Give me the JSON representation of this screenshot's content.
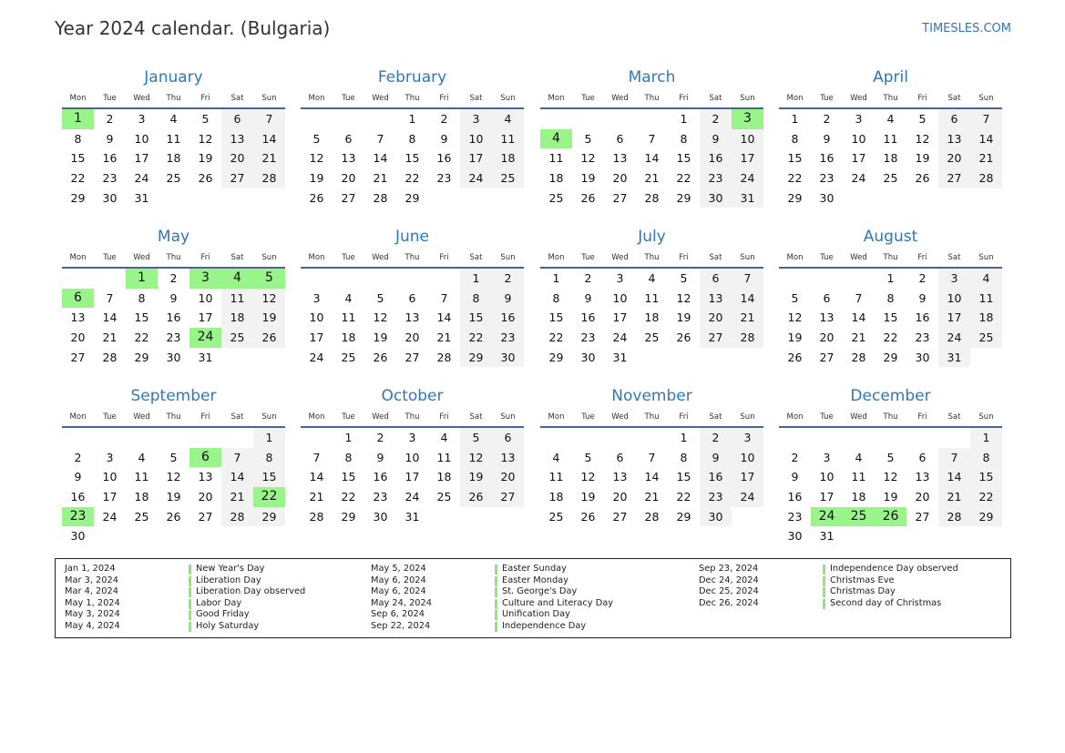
{
  "header": {
    "title": "Year 2024 calendar. (Bulgaria)",
    "site": "TIMESLES.COM"
  },
  "colors": {
    "accent": "#2f78b8",
    "holiday": "#99f58a",
    "weekend": "#f2f2f2",
    "rule": "#4a6690"
  },
  "weekdays": [
    "Mon",
    "Tue",
    "Wed",
    "Thu",
    "Fri",
    "Sat",
    "Sun"
  ],
  "months": [
    {
      "name": "January",
      "offset": 0,
      "days": 31,
      "holidays": [
        1
      ]
    },
    {
      "name": "February",
      "offset": 3,
      "days": 29,
      "holidays": []
    },
    {
      "name": "March",
      "offset": 4,
      "days": 31,
      "holidays": [
        3,
        4
      ]
    },
    {
      "name": "April",
      "offset": 0,
      "days": 30,
      "holidays": []
    },
    {
      "name": "May",
      "offset": 2,
      "days": 31,
      "holidays": [
        1,
        3,
        4,
        5,
        6,
        24
      ]
    },
    {
      "name": "June",
      "offset": 5,
      "days": 30,
      "holidays": []
    },
    {
      "name": "July",
      "offset": 0,
      "days": 31,
      "holidays": []
    },
    {
      "name": "August",
      "offset": 3,
      "days": 31,
      "holidays": []
    },
    {
      "name": "September",
      "offset": 6,
      "days": 30,
      "holidays": [
        6,
        22,
        23
      ]
    },
    {
      "name": "October",
      "offset": 1,
      "days": 31,
      "holidays": []
    },
    {
      "name": "November",
      "offset": 4,
      "days": 30,
      "holidays": []
    },
    {
      "name": "December",
      "offset": 6,
      "days": 31,
      "holidays": [
        24,
        25,
        26
      ]
    }
  ],
  "legend": [
    [
      {
        "date": "Jan 1, 2024",
        "name": "New Year's Day"
      },
      {
        "date": "Mar 3, 2024",
        "name": "Liberation Day"
      },
      {
        "date": "Mar 4, 2024",
        "name": "Liberation Day observed"
      },
      {
        "date": "May 1, 2024",
        "name": "Labor Day"
      },
      {
        "date": "May 3, 2024",
        "name": "Good Friday"
      },
      {
        "date": "May 4, 2024",
        "name": "Holy Saturday"
      }
    ],
    [
      {
        "date": "May 5, 2024",
        "name": "Easter Sunday"
      },
      {
        "date": "May 6, 2024",
        "name": "Easter Monday"
      },
      {
        "date": "May 6, 2024",
        "name": "St. George's Day"
      },
      {
        "date": "May 24, 2024",
        "name": "Culture and Literacy Day"
      },
      {
        "date": "Sep 6, 2024",
        "name": "Unification Day"
      },
      {
        "date": "Sep 22, 2024",
        "name": "Independence Day"
      }
    ],
    [
      {
        "date": "Sep 23, 2024",
        "name": "Independence Day observed"
      },
      {
        "date": "Dec 24, 2024",
        "name": "Christmas Eve"
      },
      {
        "date": "Dec 25, 2024",
        "name": "Christmas Day"
      },
      {
        "date": "Dec 26, 2024",
        "name": "Second day of Christmas"
      }
    ]
  ]
}
